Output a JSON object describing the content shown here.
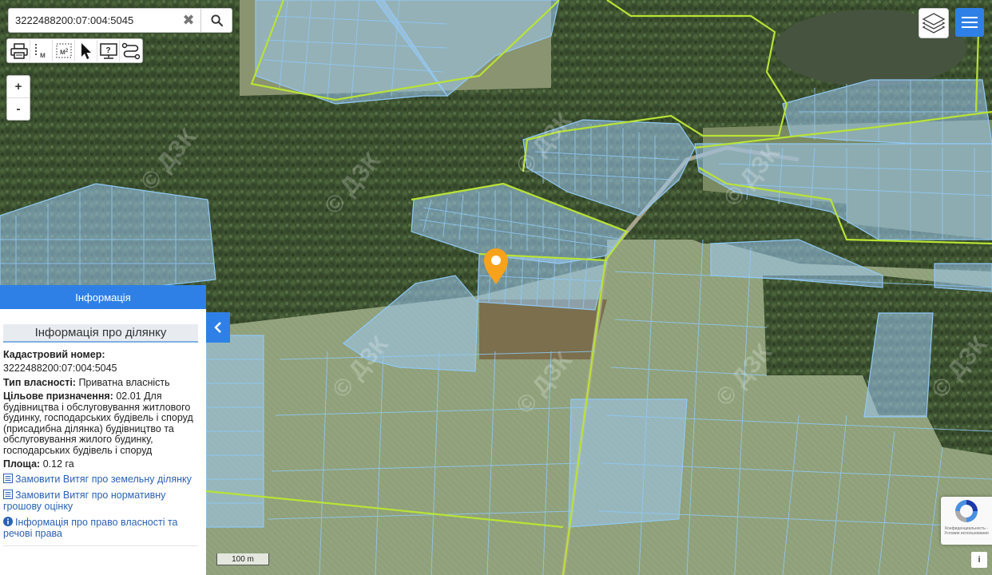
{
  "search": {
    "value": "3222488200:07:004:5045"
  },
  "toolbar": {
    "tools": [
      {
        "icon": "printer-icon"
      },
      {
        "icon": "measure-length-icon",
        "label": "м"
      },
      {
        "icon": "measure-area-icon",
        "label": "м²"
      },
      {
        "icon": "pointer-icon"
      },
      {
        "icon": "help-screen-icon",
        "label": "?"
      },
      {
        "icon": "route-icon"
      }
    ]
  },
  "zoom": {
    "in_label": "+",
    "out_label": "-"
  },
  "watermark": "© ДЗК",
  "panel": {
    "header": "Інформація",
    "title": "Інформація про ділянку",
    "cadastral_label": "Кадастровий номер:",
    "cadastral_value": "3222488200:07:004:5045",
    "ownership_label": "Тип власності:",
    "ownership_value": " Приватна власність",
    "purpose_label": "Цільове призначення:",
    "purpose_value": " 02.01 Для будівництва і обслуговування житлового будинку, господарських будівель і споруд (присадибна ділянка) будівництво та обслуговування жилого будинку, господарських будівель і споруд",
    "area_label": "Площа:",
    "area_value": " 0.12 га",
    "link_extract": "Замовити Витяг про земельну ділянку",
    "link_valuation": "Замовити Витяг про нормативну грошову оцінку",
    "link_rights": "Інформація про право власності та речові права"
  },
  "scale_label": "100 m",
  "recaptcha_text": "Конфиденциальность - Условия использования",
  "info_label": "i",
  "colors": {
    "accent": "#2f80e6",
    "parcel_fill": "#9cc9f2",
    "parcel_stroke": "#8fc8f5",
    "boundary": "#b8e335",
    "marker": "#f7a21b"
  }
}
